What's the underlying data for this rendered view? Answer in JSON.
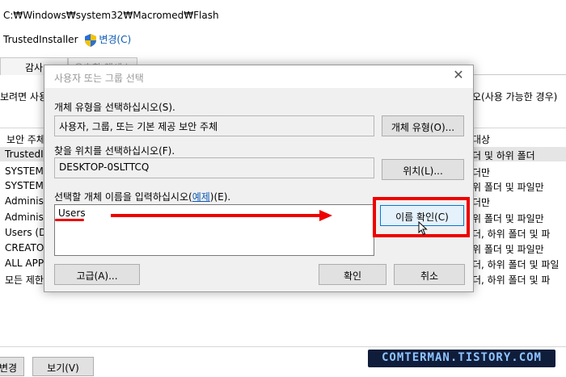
{
  "background": {
    "path": "C:₩Windows₩system32₩Macromed₩Flash",
    "owner_name": "TrustedInstaller",
    "change_link": "변경(C)",
    "tab_audit": "감사",
    "tab_effective_access": "유효한 액세스",
    "desc_left": "보려면 사용",
    "desc_right": "오(사용 가능한 경우)",
    "col_principal": "보안 주체",
    "col_applies": "대상",
    "rows": [
      {
        "principal": "TrustedIn",
        "applies": "더 및 하위 폴더"
      },
      {
        "principal": "SYSTEM",
        "applies": "더만"
      },
      {
        "principal": "SYSTEM",
        "applies": "위 폴더 및 파일만"
      },
      {
        "principal": "Administ",
        "applies": "더만"
      },
      {
        "principal": "Administ",
        "applies": "위 폴더 및 파일만"
      },
      {
        "principal": "Users (DE",
        "applies": "더, 하위 폴더 및 파"
      },
      {
        "principal": "CREATOR",
        "applies": "위 폴더 및 파일만"
      },
      {
        "principal": "ALL APPL",
        "applies": "더, 하위 폴더 및 파일"
      },
      {
        "principal": "모든 제한",
        "applies": "더, 하위 폴더 및 파"
      }
    ],
    "btn_change": "변경",
    "btn_view": "보기(V)",
    "watermark": "COMTERMAN.TISTORY.COM"
  },
  "dialog": {
    "title": "사용자 또는 그룹 선택",
    "object_type_label": "개체 유형을 선택하십시오(S).",
    "object_type_value": "사용자, 그룹, 또는 기본 제공 보안 주체",
    "object_type_button": "개체 유형(O)...",
    "location_label": "찾을 위치를 선택하십시오(F).",
    "location_value": "DESKTOP-0SLTTCQ",
    "location_button": "위치(L)...",
    "names_label_prefix": "선택할 개체 이름을 입력하십시오(",
    "names_label_link": "예제",
    "names_label_suffix": ")(E).",
    "names_value": "Users",
    "check_names_button": "이름 확인(C)",
    "advanced_button": "고급(A)...",
    "ok_button": "확인",
    "cancel_button": "취소"
  },
  "colors": {
    "annotation_red": "#e00000",
    "link_blue": "#0a58b5",
    "focus_blue": "#0078d7"
  }
}
